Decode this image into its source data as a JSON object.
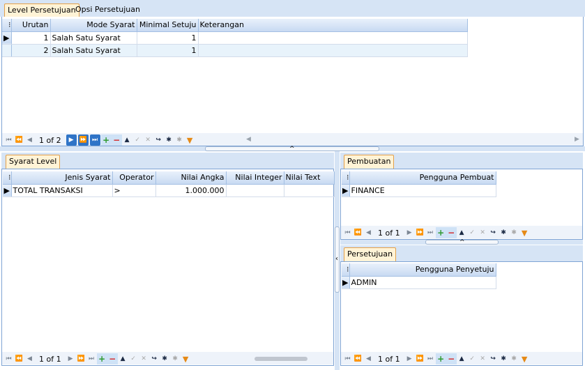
{
  "top": {
    "tabs": [
      {
        "label": "Level Persetujuan",
        "active": true
      },
      {
        "label": "Opsi Persetujuan",
        "active": false
      }
    ],
    "columns": [
      "Urutan",
      "Mode Syarat",
      "Minimal Setuju",
      "Keterangan"
    ],
    "rows": [
      {
        "urutan": "1",
        "mode": "Salah Satu Syarat",
        "minimal": "1",
        "keterangan": ""
      },
      {
        "urutan": "2",
        "mode": "Salah Satu Syarat",
        "minimal": "1",
        "keterangan": ""
      }
    ],
    "pager": "1 of 2"
  },
  "syarat": {
    "tab": "Syarat Level",
    "columns": [
      "Jenis Syarat",
      "Operator",
      "Nilai Angka",
      "Nilai Integer",
      "Nilai Text"
    ],
    "rows": [
      {
        "jenis": "TOTAL TRANSAKSI",
        "operator": ">",
        "angka": "1.000.000",
        "integer": "",
        "text": ""
      }
    ],
    "pager": "1 of 1"
  },
  "pembuatan": {
    "tab": "Pembuatan",
    "column": "Pengguna Pembuat",
    "rows": [
      "FINANCE"
    ],
    "pager": "1 of 1"
  },
  "persetujuan": {
    "tab": "Persetujuan",
    "column": "Pengguna Penyetuju",
    "rows": [
      "ADMIN"
    ],
    "pager": "1 of 1"
  },
  "colors": {
    "tab_active_bg": "#fff3d6",
    "tab_active_border": "#e3a04a",
    "header_blue": "#c8daf2",
    "accent": "#2f74c7"
  },
  "icons": [
    "first-icon",
    "prev-page-icon",
    "prev-icon",
    "next-icon",
    "next-page-icon",
    "last-icon",
    "add-icon",
    "delete-icon",
    "up-icon",
    "check-icon",
    "cancel-icon",
    "refresh-icon",
    "asterisk-icon",
    "filter-icon"
  ]
}
